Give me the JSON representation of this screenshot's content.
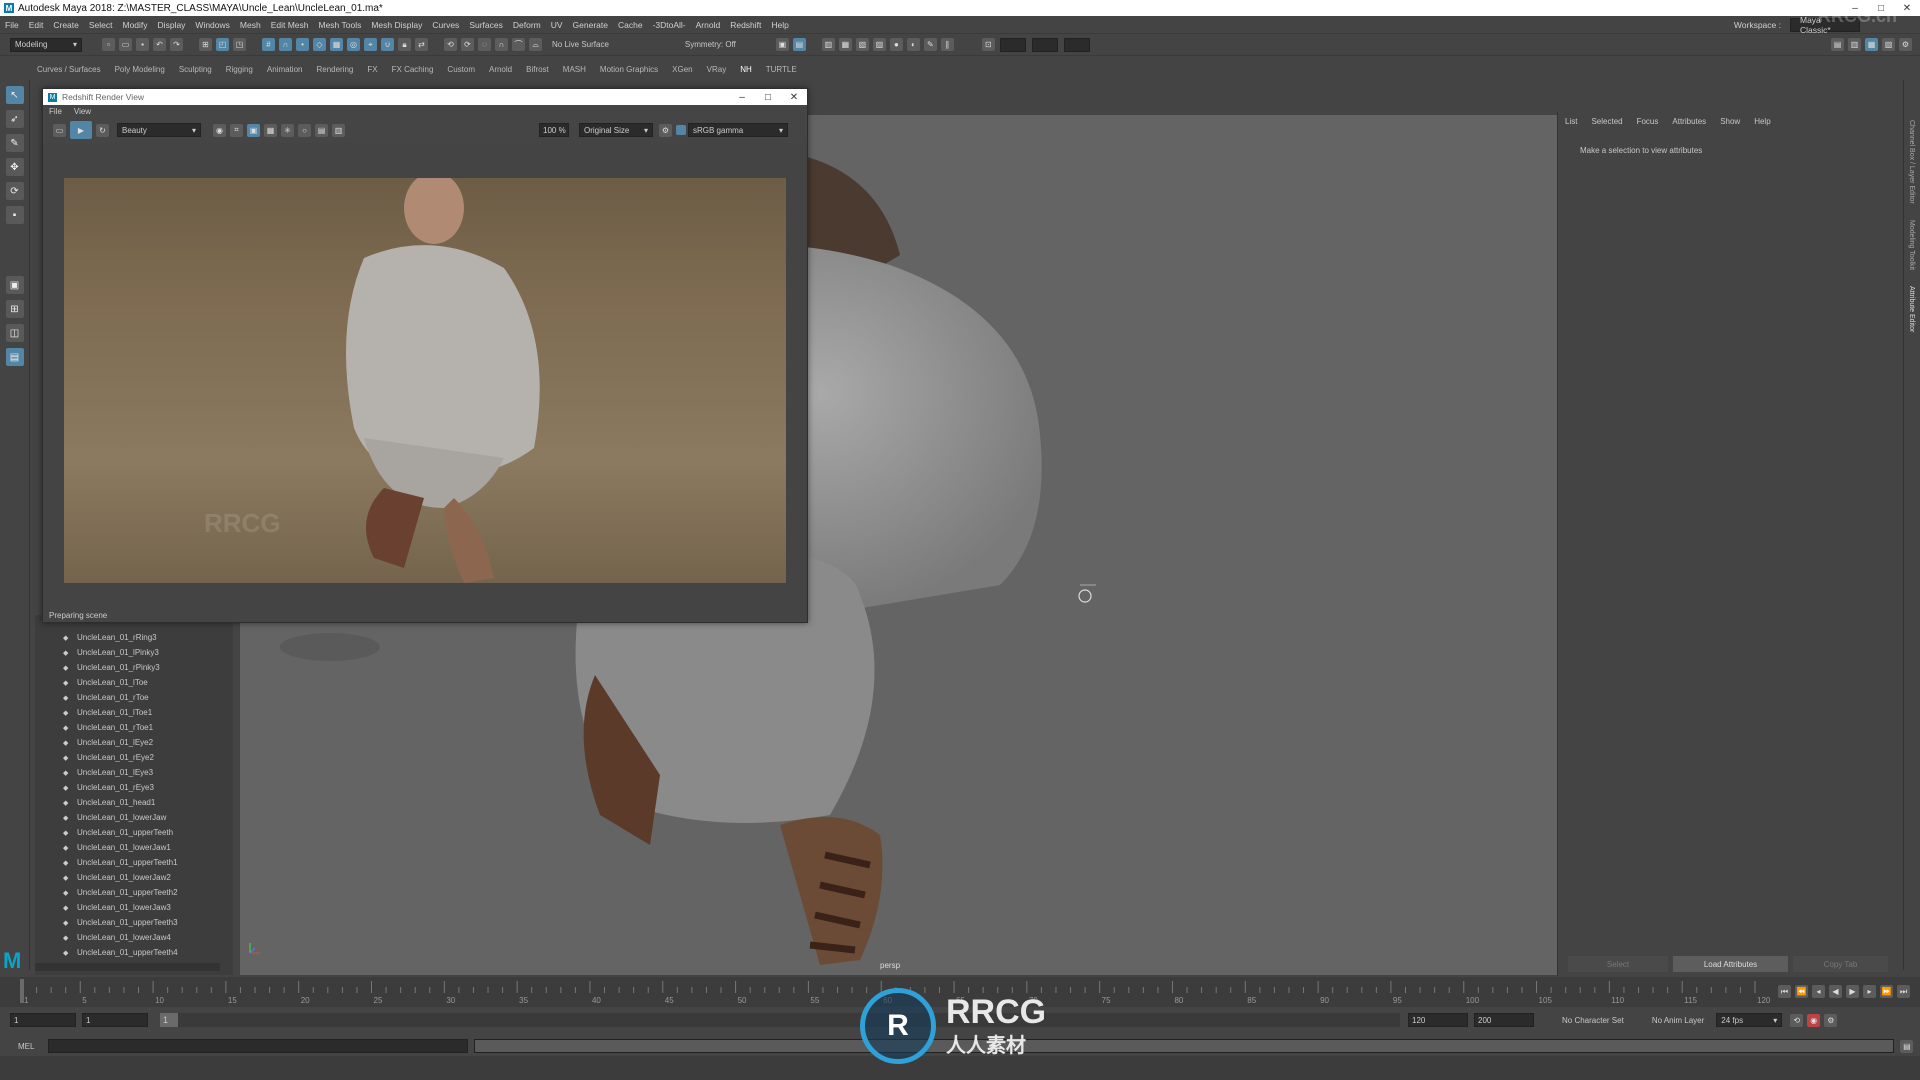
{
  "window": {
    "title": "Autodesk Maya 2018: Z:\\MASTER_CLASS\\MAYA\\Uncle_Lean\\UncleLean_01.ma*",
    "minimize": "–",
    "maximize": "□",
    "close": "✕"
  },
  "menubar": [
    "File",
    "Edit",
    "Create",
    "Select",
    "Modify",
    "Display",
    "Windows",
    "Mesh",
    "Edit Mesh",
    "Mesh Tools",
    "Mesh Display",
    "Curves",
    "Surfaces",
    "Deform",
    "UV",
    "Generate",
    "Cache",
    "-3DtoAll-",
    "Arnold",
    "Redshift",
    "Help"
  ],
  "workspace": {
    "label": "Workspace :",
    "value": "Maya Classic*"
  },
  "toolbar": {
    "mode": "Modeling",
    "live_surface": "No Live Surface",
    "symmetry": "Symmetry: Off"
  },
  "shelf_tabs": [
    "Curves / Surfaces",
    "Poly Modeling",
    "Sculpting",
    "Rigging",
    "Animation",
    "Rendering",
    "FX",
    "FX Caching",
    "Custom",
    "Arnold",
    "Bifrost",
    "MASH",
    "Motion Graphics",
    "XGen",
    "VRay",
    "NH",
    "TURTLE"
  ],
  "render_view": {
    "title": "Redshift Render View",
    "menu": [
      "File",
      "View"
    ],
    "aov": "Beauty",
    "zoom": "100 %",
    "size": "Original Size",
    "color_space": "sRGB gamma",
    "status": "Preparing scene"
  },
  "viewport": {
    "camera": "persp"
  },
  "outliner": {
    "items": [
      "UncleLean_01_rRing3",
      "UncleLean_01_lPinky3",
      "UncleLean_01_rPinky3",
      "UncleLean_01_lToe",
      "UncleLean_01_rToe",
      "UncleLean_01_lToe1",
      "UncleLean_01_rToe1",
      "UncleLean_01_lEye2",
      "UncleLean_01_rEye2",
      "UncleLean_01_lEye3",
      "UncleLean_01_rEye3",
      "UncleLean_01_head1",
      "UncleLean_01_lowerJaw",
      "UncleLean_01_upperTeeth",
      "UncleLean_01_lowerJaw1",
      "UncleLean_01_upperTeeth1",
      "UncleLean_01_lowerJaw2",
      "UncleLean_01_upperTeeth2",
      "UncleLean_01_lowerJaw3",
      "UncleLean_01_upperTeeth3",
      "UncleLean_01_lowerJaw4",
      "UncleLean_01_upperTeeth4"
    ]
  },
  "attribute_editor": {
    "tabs": [
      "List",
      "Selected",
      "Focus",
      "Attributes",
      "Show",
      "Help"
    ],
    "message": "Make a selection to view attributes",
    "select": "Select",
    "load": "Load Attributes",
    "copy": "Copy Tab"
  },
  "side_tabs": [
    "Channel Box / Layer Editor",
    "Modeling Toolkit",
    "Attribute Editor"
  ],
  "timeline": {
    "ticks": [
      "1",
      "5",
      "10",
      "15",
      "20",
      "25",
      "30",
      "35",
      "40",
      "45",
      "50",
      "55",
      "60",
      "65",
      "70",
      "75",
      "80",
      "85",
      "90",
      "95",
      "100",
      "105",
      "110",
      "115",
      "120"
    ],
    "current": "1"
  },
  "range": {
    "start": "1",
    "playback_start": "1",
    "marker": "1",
    "playback_end": "120",
    "end": "200",
    "character_set": "No Character Set",
    "anim_layer": "No Anim Layer",
    "fps": "24 fps"
  },
  "command": {
    "label": "MEL"
  },
  "watermark": {
    "text": "RRCG",
    "sub": "人人素材",
    "corner": "RRCG.cn"
  }
}
